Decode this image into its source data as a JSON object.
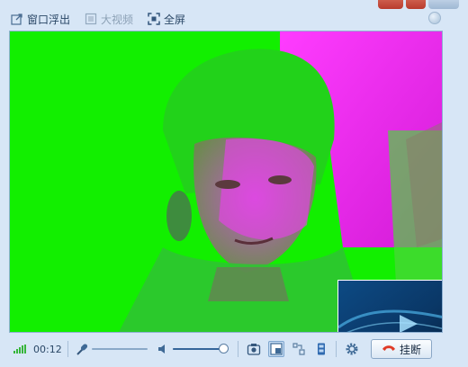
{
  "toolbar": {
    "popout_label": "窗口浮出",
    "bigvideo_label": "大视频",
    "fullscreen_label": "全屏"
  },
  "icons": {
    "popout": "popout-window-icon",
    "bigvideo": "big-video-icon",
    "fullscreen": "fullscreen-icon",
    "help": "help-icon",
    "signal": "signal-strength-icon",
    "mic": "microphone-icon",
    "speaker": "speaker-icon",
    "camera": "camera-snapshot-icon",
    "layout": "layout-icon",
    "swap": "swap-view-icon",
    "record": "record-icon",
    "settings": "gear-icon",
    "phone": "phone-hangup-icon"
  },
  "call": {
    "duration": "00:12",
    "mic_level": 0.0,
    "volume_level": 1.0
  },
  "hangup": {
    "label": "挂断"
  },
  "colors": {
    "video_green": "#10f000",
    "video_magenta": "#ff1aff",
    "hangup_red": "#e03a26",
    "signal_green": "#36b53a",
    "toolbar_text": "#2a4766"
  }
}
